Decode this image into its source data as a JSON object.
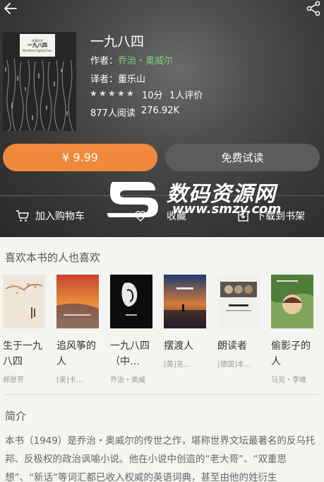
{
  "book": {
    "title": "一九八四",
    "author_label": "作者：",
    "author": "乔治・奥威尔",
    "translator_label": "译者：",
    "translator": "董乐山",
    "rating": 5,
    "score": "10分",
    "rating_count": "1人评价",
    "reads": "877人阅读",
    "size": "276.92K",
    "cover": {
      "small_text": "外国文学",
      "title_cn": "一九八四",
      "title_en": "Nineteen Eighty-Four"
    }
  },
  "buttons": {
    "buy": "¥ 9.99",
    "trial": "免费试读"
  },
  "actions": {
    "cart": "加入购物车",
    "favorite": "收藏",
    "shelf": "下载到书架"
  },
  "watermark": {
    "brand": "数码资源网",
    "url": "www.smzy.com"
  },
  "recommend": {
    "title": "喜欢本书的人也喜欢",
    "items": [
      {
        "title": "生于一九八四",
        "author": "郝景芳"
      },
      {
        "title": "追风筝的人",
        "author": "[美]卡…"
      },
      {
        "title": "一九八四（中…",
        "author": "乔治・奥威"
      },
      {
        "title": "摆渡人",
        "author": "[英]克…"
      },
      {
        "title": "朗读者",
        "author": "[德国]本…"
      },
      {
        "title": "偷影子的人",
        "author": "马克・李维"
      }
    ]
  },
  "intro": {
    "title": "简介",
    "text": "本书（1949）是乔治・奥威尔的传世之作，堪称世界文坛最著名的反乌托邦、反极权的政治讽喻小说。他在小说中创造的“老大哥”、“双重思想”、“新话”等词汇都已收入权威的英语词典，甚至由他的姓衍生"
  },
  "colors": {
    "accent": "#ef8a3c",
    "author_link": "#7ed37e",
    "trial_button": "#5c5c5c"
  }
}
